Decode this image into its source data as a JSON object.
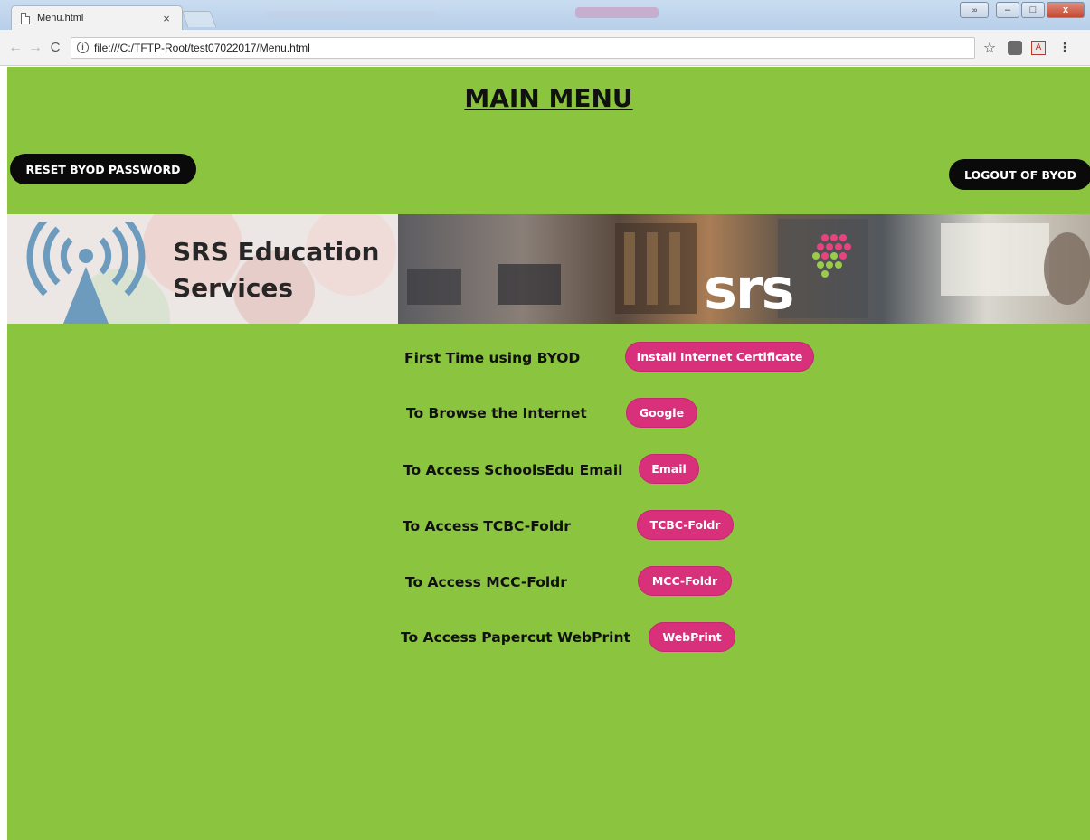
{
  "browser": {
    "tab_title": "Menu.html",
    "tab_close": "×",
    "url": "file:///C:/TFTP-Root/test07022017/Menu.html",
    "info_icon": "ⓘ",
    "back_icon": "←",
    "forward_icon": "→",
    "reload_icon": "C",
    "star_icon": "☆",
    "menu_icon": "⋮"
  },
  "page": {
    "title": "MAIN MENU",
    "reset_button": "RESET BYOD PASSWORD",
    "logout_button": "LOGOUT OF BYOD",
    "banner": {
      "line1": "SRS Education",
      "line2": "Services",
      "logo": "srs"
    },
    "rows": [
      {
        "label": "First Time using BYOD",
        "button": "Install Internet Certificate"
      },
      {
        "label": "To Browse the Internet",
        "button": "Google"
      },
      {
        "label": "To Access SchoolsEdu Email",
        "button": "Email"
      },
      {
        "label": "To Access TCBC-Foldr",
        "button": "TCBC-Foldr"
      },
      {
        "label": "To Access MCC-Foldr",
        "button": "MCC-Foldr"
      },
      {
        "label": "To Access Papercut WebPrint",
        "button": "WebPrint"
      }
    ]
  },
  "colors": {
    "page_background": "#8bc43f",
    "pink_button": "#d9307c",
    "black_button": "#0a0a0a"
  }
}
